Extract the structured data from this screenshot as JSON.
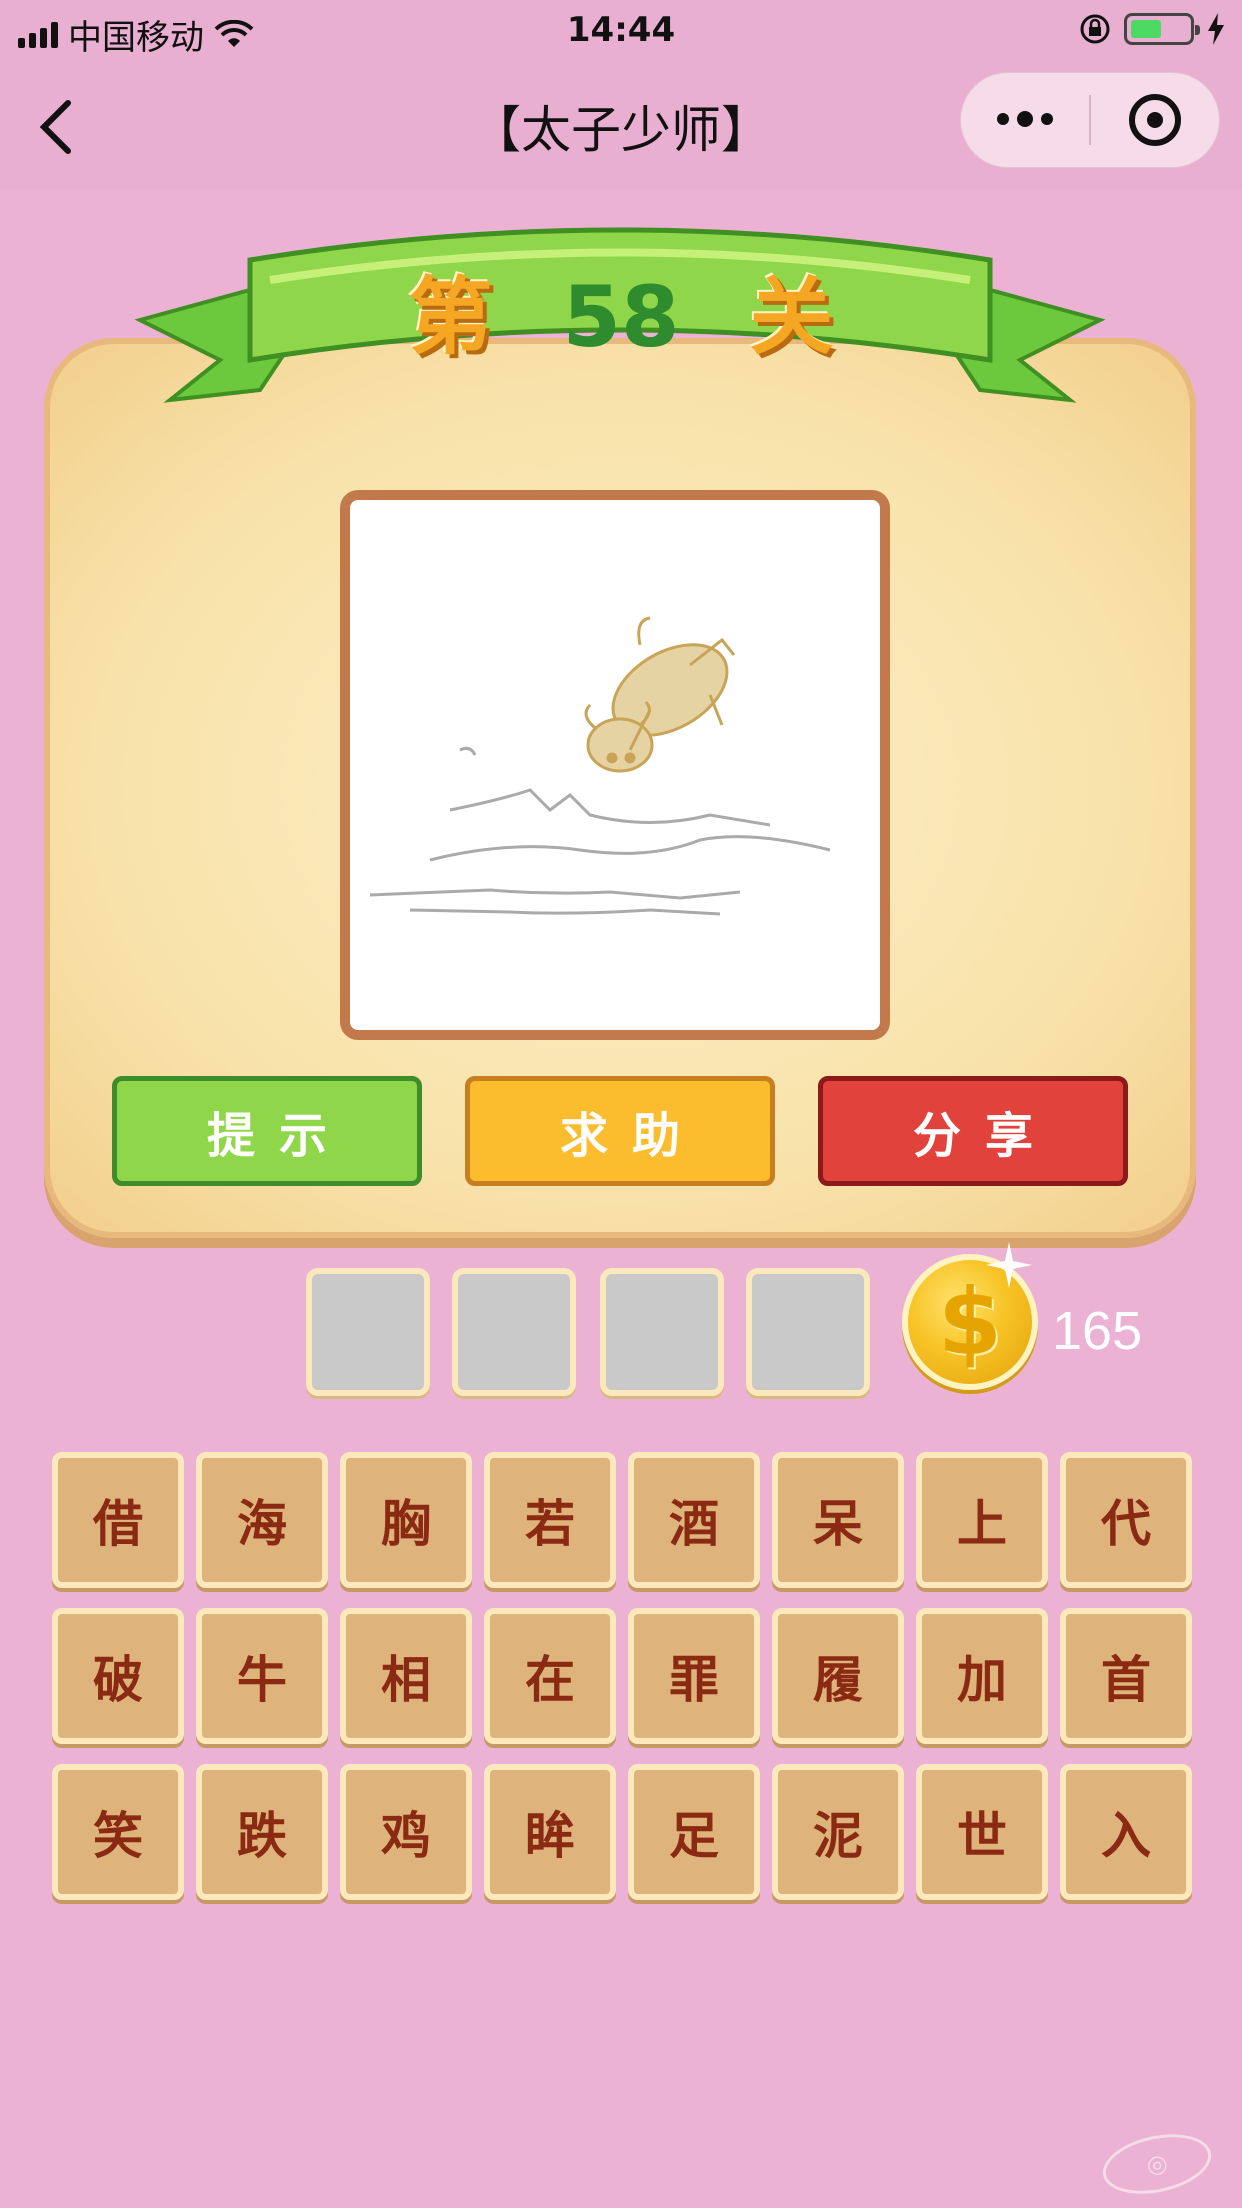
{
  "status_bar": {
    "carrier": "中国移动",
    "time": "14:44"
  },
  "nav": {
    "title": "【太子少师】"
  },
  "level": {
    "prefix": "第",
    "number": "58",
    "suffix": "关"
  },
  "actions": {
    "hint": "提示",
    "help": "求助",
    "share": "分享"
  },
  "coins": {
    "count": "165",
    "symbol": "$"
  },
  "answer_slots": [
    "",
    "",
    "",
    ""
  ],
  "tiles": [
    [
      "借",
      "海",
      "胸",
      "若",
      "酒",
      "呆",
      "上",
      "代"
    ],
    [
      "破",
      "牛",
      "相",
      "在",
      "罪",
      "履",
      "加",
      "首"
    ],
    [
      "笑",
      "跌",
      "鸡",
      "眸",
      "足",
      "泥",
      "世",
      "入"
    ]
  ],
  "colors": {
    "background": "#ecb2d4",
    "hint_button": "#8fd64a",
    "help_button": "#fbbd2e",
    "share_button": "#e2423c",
    "tile_text": "#8a2a12"
  }
}
